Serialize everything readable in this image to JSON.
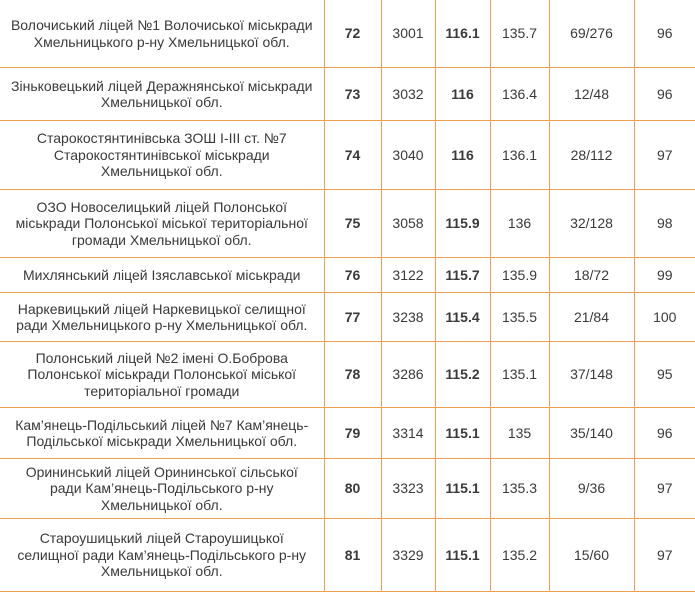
{
  "table": {
    "rows": [
      {
        "name": "Волочиський ліцей №1 Волочиської міськради Хмельницького р-ну Хмельницької обл.",
        "rank": "72",
        "code": "3001",
        "score": "116.1",
        "avg": "135.7",
        "ratio": "69/276",
        "pct": "96"
      },
      {
        "name": "Зіньковецький ліцей Деражнянської міськради Хмельницької обл.",
        "rank": "73",
        "code": "3032",
        "score": "116",
        "avg": "136.4",
        "ratio": "12/48",
        "pct": "96"
      },
      {
        "name": "Старокостянтинівська ЗОШ І-ІІІ ст. №7 Старокостянтинівської міськради Хмельницької обл.",
        "rank": "74",
        "code": "3040",
        "score": "116",
        "avg": "136.1",
        "ratio": "28/112",
        "pct": "97"
      },
      {
        "name": "ОЗО Новоселицький ліцей Полонської міськради Полонської міської територіальної громади Хмельницької обл.",
        "rank": "75",
        "code": "3058",
        "score": "115.9",
        "avg": "136",
        "ratio": "32/128",
        "pct": "98"
      },
      {
        "name": "Михлянський ліцей Ізяславської міськради",
        "rank": "76",
        "code": "3122",
        "score": "115.7",
        "avg": "135.9",
        "ratio": "18/72",
        "pct": "99"
      },
      {
        "name": "Наркевицький ліцей Наркевицької селищної ради Хмельницького р-ну Хмельницької обл.",
        "rank": "77",
        "code": "3238",
        "score": "115.4",
        "avg": "135.5",
        "ratio": "21/84",
        "pct": "100"
      },
      {
        "name": "Полонський ліцей №2 імені О.Боброва Полонської міськради Полонської міської територіальної громади",
        "rank": "78",
        "code": "3286",
        "score": "115.2",
        "avg": "135.1",
        "ratio": "37/148",
        "pct": "95"
      },
      {
        "name": "Кам’янець-Подільський ліцей №7 Кам’янець-Подільської міськради Хмельницької обл.",
        "rank": "79",
        "code": "3314",
        "score": "115.1",
        "avg": "135",
        "ratio": "35/140",
        "pct": "96"
      },
      {
        "name": "Орининський ліцей Орининської сільської ради Кам’янець-Подільського р-ну Хмельницької обл.",
        "rank": "80",
        "code": "3323",
        "score": "115.1",
        "avg": "135.3",
        "ratio": "9/36",
        "pct": "97"
      },
      {
        "name": "Староушицький ліцей Староушицької селищної ради Кам’янець-Подільського р-ну Хмельницької обл.",
        "rank": "81",
        "code": "3329",
        "score": "115.1",
        "avg": "135.2",
        "ratio": "15/60",
        "pct": "97"
      }
    ]
  },
  "colors": {
    "border": "#f0a050",
    "text": "#3a3a3a",
    "background": "#ffffff"
  }
}
